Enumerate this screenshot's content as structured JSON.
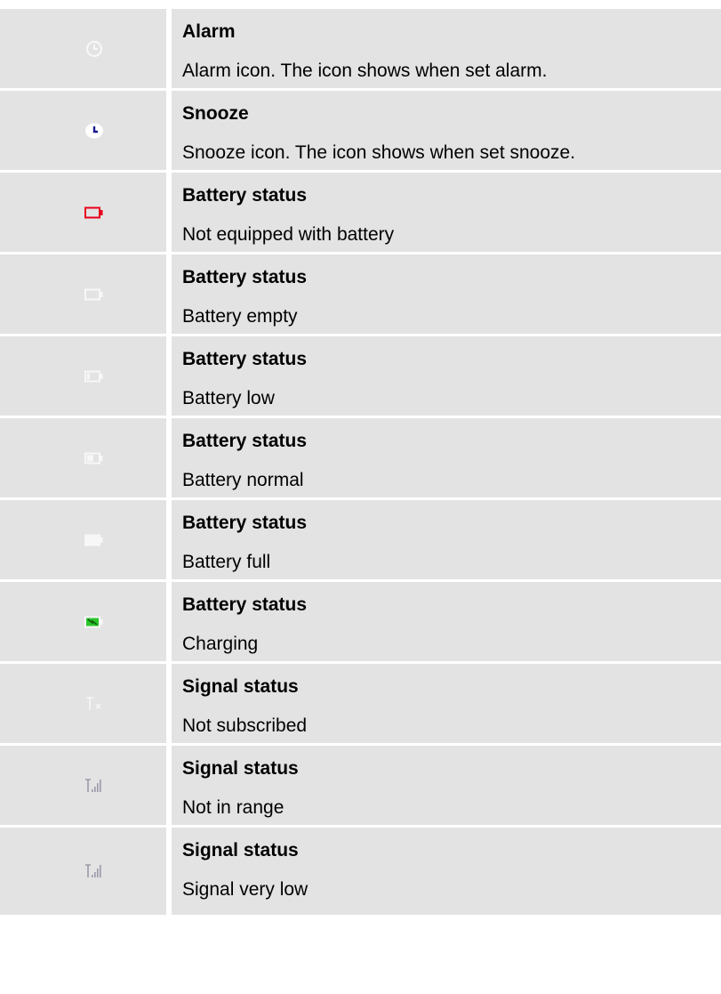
{
  "colors": {
    "cell_bg": "#e3e3e3",
    "icon_light": "#f7f7f7",
    "icon_outline": "#ffffff",
    "battery_red": "#e8001c",
    "charging_green": "#2bc42b",
    "snooze_blue": "#1a1a8c",
    "signal_grey": "#9a9aaa"
  },
  "rows": [
    {
      "icon": "alarm-clock-icon",
      "title": "Alarm",
      "description": "Alarm icon. The icon shows when set alarm."
    },
    {
      "icon": "snooze-clock-icon",
      "title": "Snooze",
      "description": "Snooze icon. The icon shows when set snooze."
    },
    {
      "icon": "battery-red-outline-icon",
      "title": "Battery status",
      "description": "Not equipped with battery"
    },
    {
      "icon": "battery-empty-icon",
      "title": "Battery status",
      "description": "Battery empty"
    },
    {
      "icon": "battery-low-icon",
      "title": "Battery status",
      "description": "Battery low"
    },
    {
      "icon": "battery-normal-icon",
      "title": "Battery status",
      "description": "Battery normal"
    },
    {
      "icon": "battery-full-icon",
      "title": "Battery status",
      "description": "Battery full"
    },
    {
      "icon": "battery-charging-icon",
      "title": "Battery status",
      "description": "Charging"
    },
    {
      "icon": "antenna-x-icon",
      "title": "Signal status",
      "description": "Not subscribed"
    },
    {
      "icon": "signal-bars-icon",
      "title": "Signal status",
      "description": "Not in range"
    },
    {
      "icon": "signal-bars-icon",
      "title": "Signal status",
      "description": "Signal very low"
    }
  ]
}
